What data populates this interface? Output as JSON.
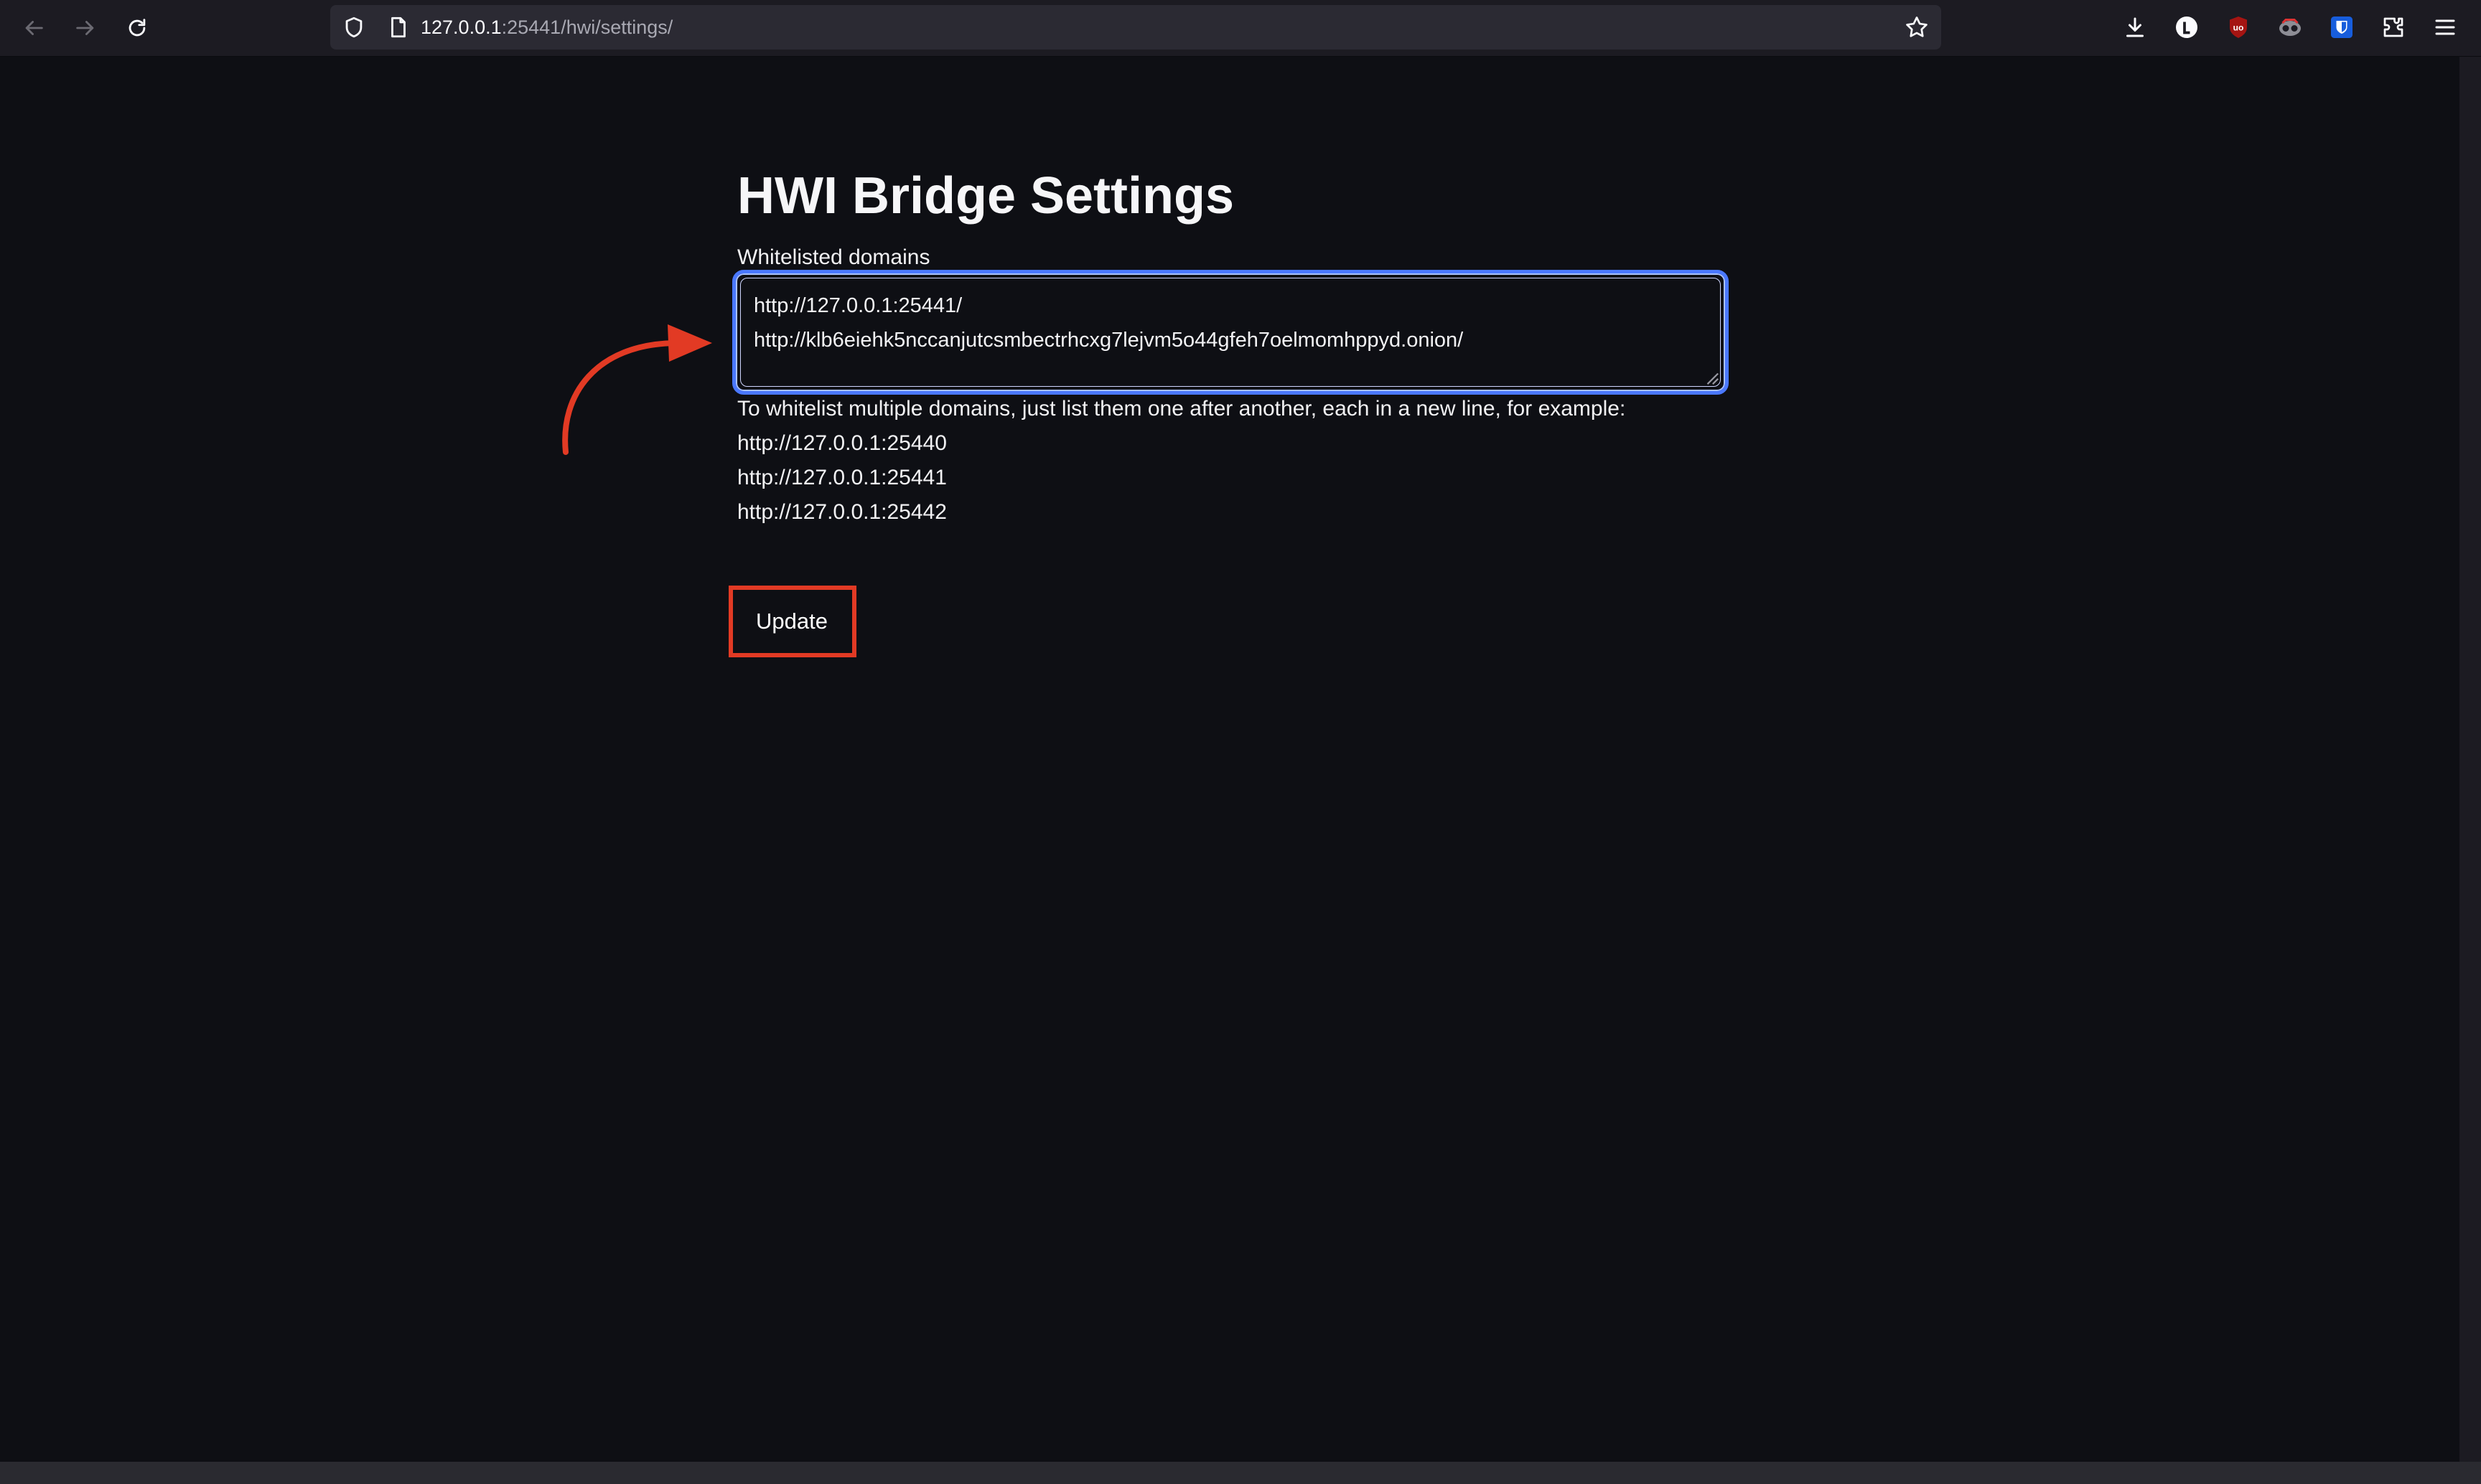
{
  "browser": {
    "url_host": "127.0.0.1",
    "url_rest": ":25441/hwi/settings/",
    "extensions": [
      "download-icon",
      "l-circle-icon",
      "ublock-icon",
      "privacy-badger-icon",
      "bitwarden-shield-icon",
      "puzzle-extensions-icon",
      "hamburger-menu-icon"
    ]
  },
  "page": {
    "title": "HWI Bridge Settings",
    "field_label": "Whitelisted domains",
    "domains_value": "http://127.0.0.1:25441/\nhttp://klb6eiehk5nccanjutcsmbectrhcxg7lejvm5o44gfeh7oelmomhppyd.onion/",
    "help_text": "To whitelist multiple domains, just list them one after another, each in a new line, for example:",
    "examples": [
      "http://127.0.0.1:25440",
      "http://127.0.0.1:25441",
      "http://127.0.0.1:25442"
    ],
    "update_label": "Update"
  },
  "colors": {
    "background": "#0e0f14",
    "focus_ring": "#4a78ff",
    "annotation_red": "#e23a24"
  }
}
